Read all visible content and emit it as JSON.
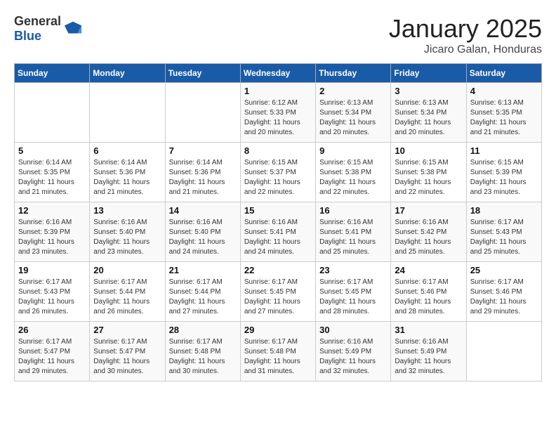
{
  "logo": {
    "general": "General",
    "blue": "Blue"
  },
  "header": {
    "month": "January 2025",
    "location": "Jicaro Galan, Honduras"
  },
  "weekdays": [
    "Sunday",
    "Monday",
    "Tuesday",
    "Wednesday",
    "Thursday",
    "Friday",
    "Saturday"
  ],
  "weeks": [
    [
      {
        "day": "",
        "sunrise": "",
        "sunset": "",
        "daylight": ""
      },
      {
        "day": "",
        "sunrise": "",
        "sunset": "",
        "daylight": ""
      },
      {
        "day": "",
        "sunrise": "",
        "sunset": "",
        "daylight": ""
      },
      {
        "day": "1",
        "sunrise": "Sunrise: 6:12 AM",
        "sunset": "Sunset: 5:33 PM",
        "daylight": "Daylight: 11 hours and 20 minutes."
      },
      {
        "day": "2",
        "sunrise": "Sunrise: 6:13 AM",
        "sunset": "Sunset: 5:34 PM",
        "daylight": "Daylight: 11 hours and 20 minutes."
      },
      {
        "day": "3",
        "sunrise": "Sunrise: 6:13 AM",
        "sunset": "Sunset: 5:34 PM",
        "daylight": "Daylight: 11 hours and 20 minutes."
      },
      {
        "day": "4",
        "sunrise": "Sunrise: 6:13 AM",
        "sunset": "Sunset: 5:35 PM",
        "daylight": "Daylight: 11 hours and 21 minutes."
      }
    ],
    [
      {
        "day": "5",
        "sunrise": "Sunrise: 6:14 AM",
        "sunset": "Sunset: 5:35 PM",
        "daylight": "Daylight: 11 hours and 21 minutes."
      },
      {
        "day": "6",
        "sunrise": "Sunrise: 6:14 AM",
        "sunset": "Sunset: 5:36 PM",
        "daylight": "Daylight: 11 hours and 21 minutes."
      },
      {
        "day": "7",
        "sunrise": "Sunrise: 6:14 AM",
        "sunset": "Sunset: 5:36 PM",
        "daylight": "Daylight: 11 hours and 21 minutes."
      },
      {
        "day": "8",
        "sunrise": "Sunrise: 6:15 AM",
        "sunset": "Sunset: 5:37 PM",
        "daylight": "Daylight: 11 hours and 22 minutes."
      },
      {
        "day": "9",
        "sunrise": "Sunrise: 6:15 AM",
        "sunset": "Sunset: 5:38 PM",
        "daylight": "Daylight: 11 hours and 22 minutes."
      },
      {
        "day": "10",
        "sunrise": "Sunrise: 6:15 AM",
        "sunset": "Sunset: 5:38 PM",
        "daylight": "Daylight: 11 hours and 22 minutes."
      },
      {
        "day": "11",
        "sunrise": "Sunrise: 6:15 AM",
        "sunset": "Sunset: 5:39 PM",
        "daylight": "Daylight: 11 hours and 23 minutes."
      }
    ],
    [
      {
        "day": "12",
        "sunrise": "Sunrise: 6:16 AM",
        "sunset": "Sunset: 5:39 PM",
        "daylight": "Daylight: 11 hours and 23 minutes."
      },
      {
        "day": "13",
        "sunrise": "Sunrise: 6:16 AM",
        "sunset": "Sunset: 5:40 PM",
        "daylight": "Daylight: 11 hours and 23 minutes."
      },
      {
        "day": "14",
        "sunrise": "Sunrise: 6:16 AM",
        "sunset": "Sunset: 5:40 PM",
        "daylight": "Daylight: 11 hours and 24 minutes."
      },
      {
        "day": "15",
        "sunrise": "Sunrise: 6:16 AM",
        "sunset": "Sunset: 5:41 PM",
        "daylight": "Daylight: 11 hours and 24 minutes."
      },
      {
        "day": "16",
        "sunrise": "Sunrise: 6:16 AM",
        "sunset": "Sunset: 5:41 PM",
        "daylight": "Daylight: 11 hours and 25 minutes."
      },
      {
        "day": "17",
        "sunrise": "Sunrise: 6:16 AM",
        "sunset": "Sunset: 5:42 PM",
        "daylight": "Daylight: 11 hours and 25 minutes."
      },
      {
        "day": "18",
        "sunrise": "Sunrise: 6:17 AM",
        "sunset": "Sunset: 5:43 PM",
        "daylight": "Daylight: 11 hours and 25 minutes."
      }
    ],
    [
      {
        "day": "19",
        "sunrise": "Sunrise: 6:17 AM",
        "sunset": "Sunset: 5:43 PM",
        "daylight": "Daylight: 11 hours and 26 minutes."
      },
      {
        "day": "20",
        "sunrise": "Sunrise: 6:17 AM",
        "sunset": "Sunset: 5:44 PM",
        "daylight": "Daylight: 11 hours and 26 minutes."
      },
      {
        "day": "21",
        "sunrise": "Sunrise: 6:17 AM",
        "sunset": "Sunset: 5:44 PM",
        "daylight": "Daylight: 11 hours and 27 minutes."
      },
      {
        "day": "22",
        "sunrise": "Sunrise: 6:17 AM",
        "sunset": "Sunset: 5:45 PM",
        "daylight": "Daylight: 11 hours and 27 minutes."
      },
      {
        "day": "23",
        "sunrise": "Sunrise: 6:17 AM",
        "sunset": "Sunset: 5:45 PM",
        "daylight": "Daylight: 11 hours and 28 minutes."
      },
      {
        "day": "24",
        "sunrise": "Sunrise: 6:17 AM",
        "sunset": "Sunset: 5:46 PM",
        "daylight": "Daylight: 11 hours and 28 minutes."
      },
      {
        "day": "25",
        "sunrise": "Sunrise: 6:17 AM",
        "sunset": "Sunset: 5:46 PM",
        "daylight": "Daylight: 11 hours and 29 minutes."
      }
    ],
    [
      {
        "day": "26",
        "sunrise": "Sunrise: 6:17 AM",
        "sunset": "Sunset: 5:47 PM",
        "daylight": "Daylight: 11 hours and 29 minutes."
      },
      {
        "day": "27",
        "sunrise": "Sunrise: 6:17 AM",
        "sunset": "Sunset: 5:47 PM",
        "daylight": "Daylight: 11 hours and 30 minutes."
      },
      {
        "day": "28",
        "sunrise": "Sunrise: 6:17 AM",
        "sunset": "Sunset: 5:48 PM",
        "daylight": "Daylight: 11 hours and 30 minutes."
      },
      {
        "day": "29",
        "sunrise": "Sunrise: 6:17 AM",
        "sunset": "Sunset: 5:48 PM",
        "daylight": "Daylight: 11 hours and 31 minutes."
      },
      {
        "day": "30",
        "sunrise": "Sunrise: 6:16 AM",
        "sunset": "Sunset: 5:49 PM",
        "daylight": "Daylight: 11 hours and 32 minutes."
      },
      {
        "day": "31",
        "sunrise": "Sunrise: 6:16 AM",
        "sunset": "Sunset: 5:49 PM",
        "daylight": "Daylight: 11 hours and 32 minutes."
      },
      {
        "day": "",
        "sunrise": "",
        "sunset": "",
        "daylight": ""
      }
    ]
  ]
}
